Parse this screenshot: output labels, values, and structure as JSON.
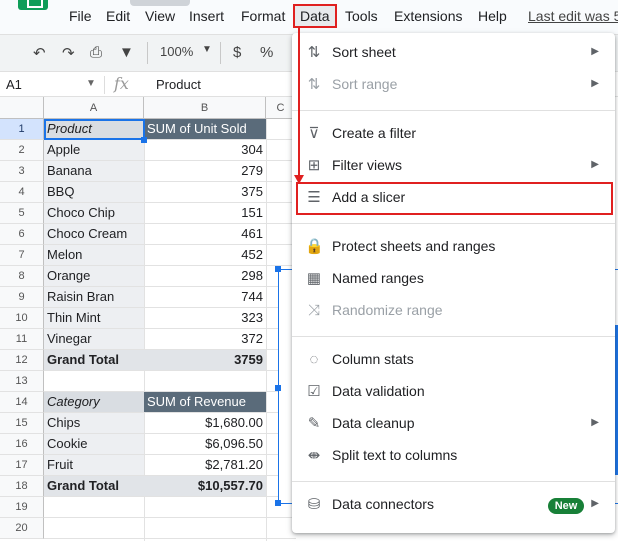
{
  "menubar": {
    "items": [
      "File",
      "Edit",
      "View",
      "Insert",
      "Format",
      "Data",
      "Tools",
      "Extensions",
      "Help"
    ],
    "last_edit": "Last edit was 5"
  },
  "toolbar": {
    "zoom": "100%",
    "currency": "$",
    "percent": "%"
  },
  "formula_bar": {
    "cell_ref": "A1",
    "fx": "fx",
    "value": "Product"
  },
  "columns": [
    "A",
    "B",
    "C"
  ],
  "rows": [
    "1",
    "2",
    "3",
    "4",
    "5",
    "6",
    "7",
    "8",
    "9",
    "10",
    "11",
    "12",
    "13",
    "14",
    "15",
    "16",
    "17",
    "18",
    "19",
    "20"
  ],
  "pivot1": {
    "header": [
      "Product",
      "SUM of Unit Sold"
    ],
    "rows": [
      [
        "Apple",
        "304"
      ],
      [
        "Banana",
        "279"
      ],
      [
        "BBQ",
        "375"
      ],
      [
        "Choco Chip",
        "151"
      ],
      [
        "Choco Cream",
        "461"
      ],
      [
        "Melon",
        "452"
      ],
      [
        "Orange",
        "298"
      ],
      [
        "Raisin Bran",
        "744"
      ],
      [
        "Thin Mint",
        "323"
      ],
      [
        "Vinegar",
        "372"
      ]
    ],
    "total": [
      "Grand Total",
      "3759"
    ]
  },
  "pivot2": {
    "header": [
      "Category",
      "SUM of Revenue"
    ],
    "rows": [
      [
        "Chips",
        "$1,680.00"
      ],
      [
        "Cookie",
        "$6,096.50"
      ],
      [
        "Fruit",
        "$2,781.20"
      ]
    ],
    "total": [
      "Grand Total",
      "$10,557.70"
    ]
  },
  "data_menu": {
    "items": [
      {
        "label": "Sort sheet",
        "icon": "sort-icon",
        "submenu": true,
        "disabled": false
      },
      {
        "label": "Sort range",
        "icon": "sort-range-icon",
        "submenu": true,
        "disabled": true
      },
      {
        "label": "Create a filter",
        "icon": "filter-icon",
        "submenu": false,
        "disabled": false
      },
      {
        "label": "Filter views",
        "icon": "filter-views-icon",
        "submenu": true,
        "disabled": false
      },
      {
        "label": "Add a slicer",
        "icon": "slicer-icon",
        "submenu": false,
        "disabled": false
      },
      {
        "label": "Protect sheets and ranges",
        "icon": "lock-icon",
        "submenu": false,
        "disabled": false
      },
      {
        "label": "Named ranges",
        "icon": "named-ranges-icon",
        "submenu": false,
        "disabled": false
      },
      {
        "label": "Randomize range",
        "icon": "shuffle-icon",
        "submenu": false,
        "disabled": true
      },
      {
        "label": "Column stats",
        "icon": "lightbulb-icon",
        "submenu": false,
        "disabled": false
      },
      {
        "label": "Data validation",
        "icon": "data-validation-icon",
        "submenu": false,
        "disabled": false
      },
      {
        "label": "Data cleanup",
        "icon": "wand-icon",
        "submenu": true,
        "disabled": false
      },
      {
        "label": "Split text to columns",
        "icon": "split-icon",
        "submenu": false,
        "disabled": false
      },
      {
        "label": "Data connectors",
        "icon": "database-icon",
        "submenu": true,
        "disabled": false,
        "badge": "New"
      }
    ]
  },
  "colors": {
    "accent": "#1a73e8",
    "highlight": "#e02020",
    "pivot_header": "#5a6b7a",
    "badge": "#188038"
  }
}
